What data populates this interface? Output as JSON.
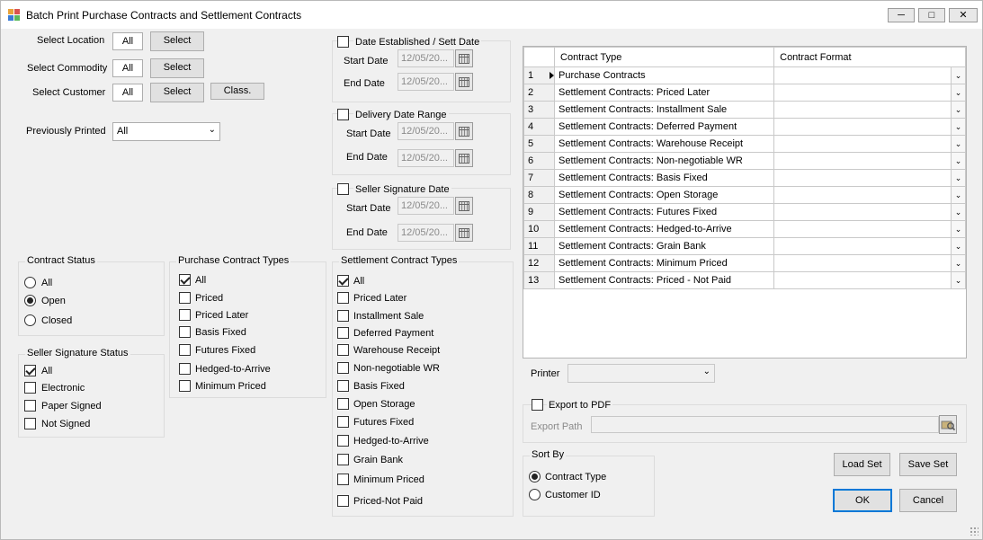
{
  "window": {
    "title": "Batch Print Purchase Contracts and Settlement Contracts"
  },
  "filters": {
    "location": {
      "label": "Select Location",
      "value": "All",
      "button": "Select"
    },
    "commodity": {
      "label": "Select Commodity",
      "value": "All",
      "button": "Select"
    },
    "customer": {
      "label": "Select Customer",
      "value": "All",
      "button": "Select",
      "class_button": "Class."
    },
    "previously_printed": {
      "label": "Previously Printed",
      "value": "All"
    }
  },
  "date_groups": [
    {
      "title": "Date Established / Sett Date",
      "checked": false,
      "start_label": "Start Date",
      "start_value": "12/05/20...",
      "end_label": "End Date",
      "end_value": "12/05/20..."
    },
    {
      "title": "Delivery Date Range",
      "checked": false,
      "start_label": "Start Date",
      "start_value": "12/05/20...",
      "end_label": "End Date",
      "end_value": "12/05/20..."
    },
    {
      "title": "Seller Signature Date",
      "checked": false,
      "start_label": "Start Date",
      "start_value": "12/05/20...",
      "end_label": "End Date",
      "end_value": "12/05/20..."
    }
  ],
  "contract_status": {
    "title": "Contract Status",
    "options": [
      {
        "label": "All",
        "selected": false
      },
      {
        "label": "Open",
        "selected": true
      },
      {
        "label": "Closed",
        "selected": false
      }
    ]
  },
  "seller_signature_status": {
    "title": "Seller Signature Status",
    "options": [
      {
        "label": "All",
        "checked": true
      },
      {
        "label": "Electronic",
        "checked": false
      },
      {
        "label": "Paper Signed",
        "checked": false
      },
      {
        "label": "Not Signed",
        "checked": false
      }
    ]
  },
  "purchase_contract_types": {
    "title": "Purchase Contract Types",
    "options": [
      {
        "label": "All",
        "checked": true
      },
      {
        "label": "Priced",
        "checked": false
      },
      {
        "label": "Priced Later",
        "checked": false
      },
      {
        "label": "Basis Fixed",
        "checked": false
      },
      {
        "label": "Futures Fixed",
        "checked": false
      },
      {
        "label": "Hedged-to-Arrive",
        "checked": false
      },
      {
        "label": "Minimum Priced",
        "checked": false
      }
    ]
  },
  "settlement_contract_types": {
    "title": "Settlement Contract Types",
    "options": [
      {
        "label": "All",
        "checked": true
      },
      {
        "label": "Priced Later",
        "checked": false
      },
      {
        "label": "Installment Sale",
        "checked": false
      },
      {
        "label": "Deferred Payment",
        "checked": false
      },
      {
        "label": "Warehouse Receipt",
        "checked": false
      },
      {
        "label": "Non-negotiable WR",
        "checked": false
      },
      {
        "label": "Basis Fixed",
        "checked": false
      },
      {
        "label": "Open Storage",
        "checked": false
      },
      {
        "label": "Futures Fixed",
        "checked": false
      },
      {
        "label": "Hedged-to-Arrive",
        "checked": false
      },
      {
        "label": "Grain Bank",
        "checked": false
      },
      {
        "label": "Minimum Priced",
        "checked": false
      },
      {
        "label": "Priced-Not Paid",
        "checked": false
      }
    ]
  },
  "grid": {
    "columns": [
      "Contract Type",
      "Contract Format"
    ],
    "rows": [
      {
        "num": "1",
        "type": "Purchase Contracts",
        "format": ""
      },
      {
        "num": "2",
        "type": "Settlement Contracts: Priced Later",
        "format": ""
      },
      {
        "num": "3",
        "type": "Settlement Contracts: Installment Sale",
        "format": ""
      },
      {
        "num": "4",
        "type": "Settlement Contracts: Deferred Payment",
        "format": ""
      },
      {
        "num": "5",
        "type": "Settlement Contracts: Warehouse Receipt",
        "format": ""
      },
      {
        "num": "6",
        "type": "Settlement Contracts: Non-negotiable WR",
        "format": ""
      },
      {
        "num": "7",
        "type": "Settlement Contracts: Basis Fixed",
        "format": ""
      },
      {
        "num": "8",
        "type": "Settlement Contracts: Open Storage",
        "format": ""
      },
      {
        "num": "9",
        "type": "Settlement Contracts: Futures Fixed",
        "format": ""
      },
      {
        "num": "10",
        "type": "Settlement Contracts: Hedged-to-Arrive",
        "format": ""
      },
      {
        "num": "11",
        "type": "Settlement Contracts: Grain Bank",
        "format": ""
      },
      {
        "num": "12",
        "type": "Settlement Contracts: Minimum Priced",
        "format": ""
      },
      {
        "num": "13",
        "type": "Settlement Contracts: Priced - Not Paid",
        "format": ""
      }
    ]
  },
  "printer": {
    "label": "Printer",
    "value": ""
  },
  "export": {
    "checkbox_label": "Export to PDF",
    "checked": false,
    "path_label": "Export Path",
    "path_value": ""
  },
  "sort_by": {
    "title": "Sort By",
    "options": [
      {
        "label": "Contract Type",
        "selected": true
      },
      {
        "label": "Customer ID",
        "selected": false
      }
    ]
  },
  "buttons": {
    "load_set": "Load Set",
    "save_set": "Save Set",
    "ok": "OK",
    "cancel": "Cancel"
  }
}
